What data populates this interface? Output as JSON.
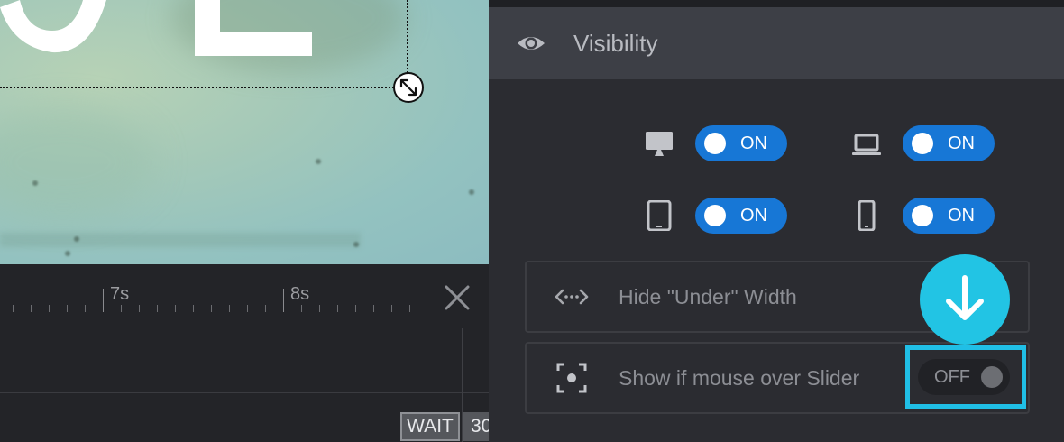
{
  "timeline": {
    "tick_labels": [
      "7s",
      "8s"
    ],
    "wait_label": "WAIT",
    "duration_value": "30"
  },
  "panel": {
    "header_title": "Visibility",
    "devices": [
      {
        "icon": "desktop-icon",
        "state": "ON"
      },
      {
        "icon": "laptop-icon",
        "state": "ON"
      },
      {
        "icon": "tablet-icon",
        "state": "ON"
      },
      {
        "icon": "phone-icon",
        "state": "ON"
      }
    ],
    "hide_under_width_label": "Hide \"Under\" Width",
    "show_mouse_over_label": "Show if mouse over Slider",
    "show_mouse_over_state": "OFF"
  },
  "colors": {
    "toggle_on": "#1777d6",
    "highlight": "#20bfe6",
    "panel_bg": "#2b2c31",
    "header_bg": "#3d3f46"
  }
}
